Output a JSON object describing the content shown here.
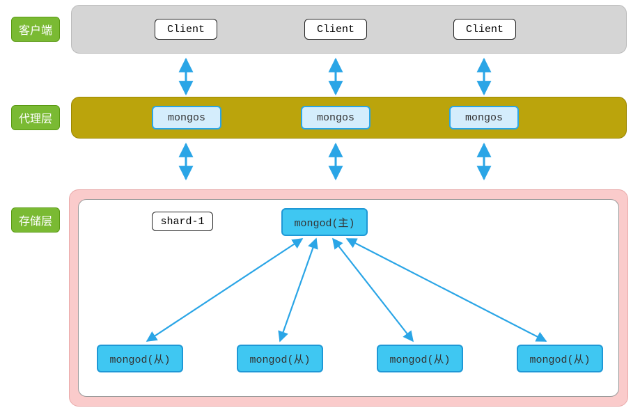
{
  "labels": {
    "client": "客户端",
    "proxy": "代理层",
    "storage": "存储层"
  },
  "clients": [
    "Client",
    "Client",
    "Client"
  ],
  "mongos": [
    "mongos",
    "mongos",
    "mongos"
  ],
  "shard": {
    "name": "shard-1",
    "primary": "mongod(主)",
    "secondaries": [
      "mongod(从)",
      "mongod(从)",
      "mongod(从)",
      "mongod(从)"
    ]
  },
  "colors": {
    "layerLabel": "#7aba33",
    "clientRow": "#d5d5d5",
    "proxyRow": "#bba40c",
    "storageOuter": "#facbcb",
    "mongosFill": "#d4edfc",
    "mongodFill": "#3fc7f2",
    "arrow": "#2aa5e6"
  }
}
